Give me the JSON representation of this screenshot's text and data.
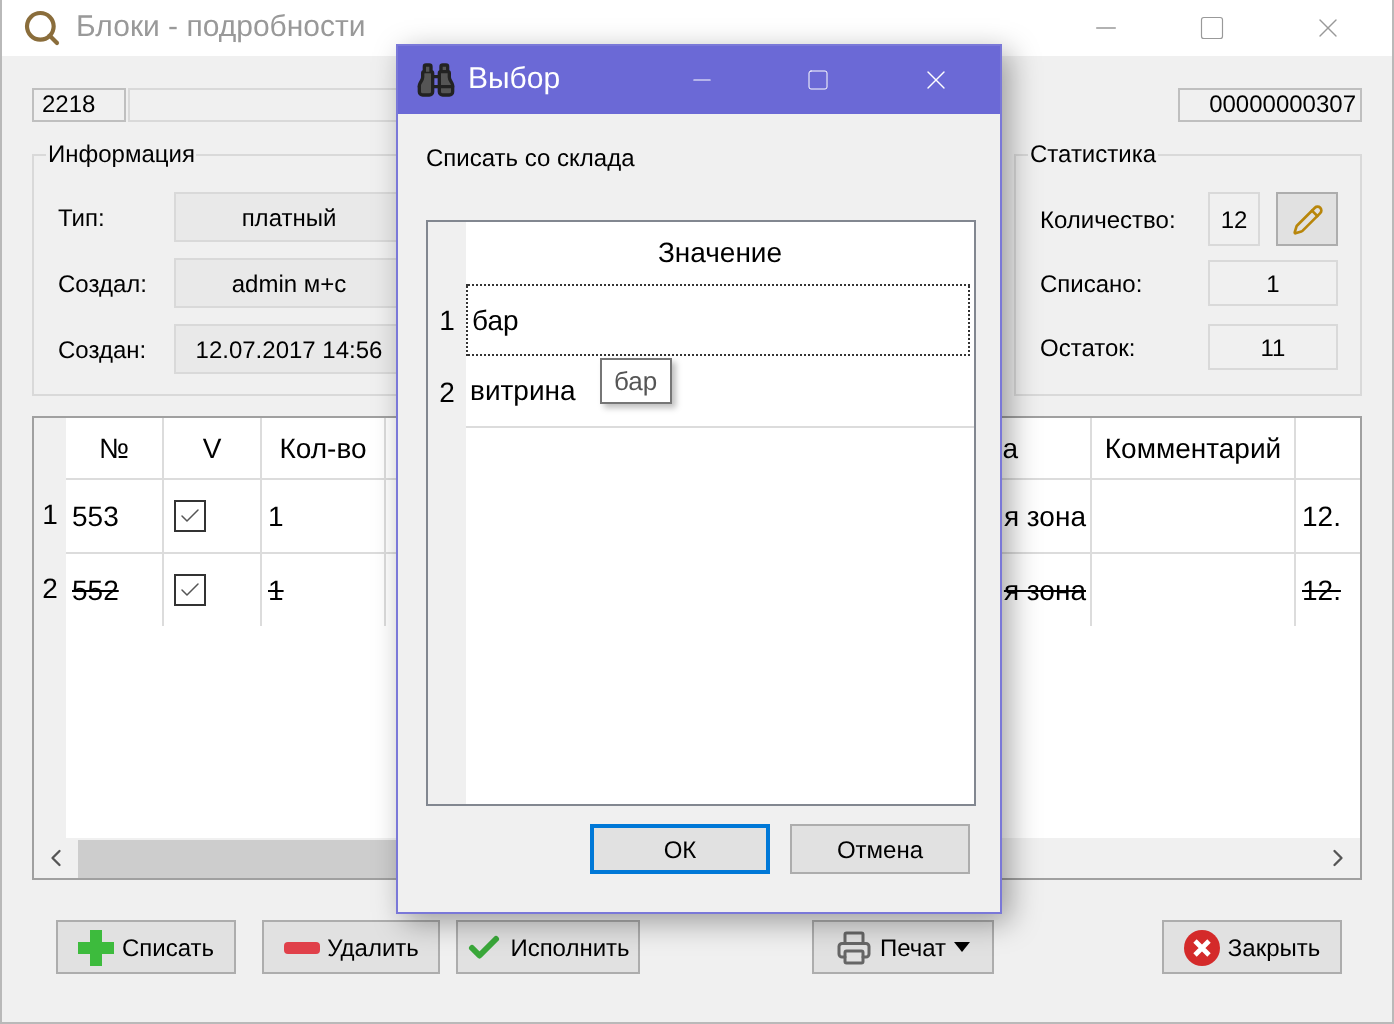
{
  "window": {
    "title": "Блоки - подробности"
  },
  "header_fields": {
    "number": "2218",
    "code": "00000000307"
  },
  "info": {
    "title": "Информация",
    "rows": [
      {
        "label": "Тип:",
        "value": "платный"
      },
      {
        "label": "Создал:",
        "value": "admin м+с"
      },
      {
        "label": "Создан:",
        "value": "12.07.2017 14:56"
      }
    ]
  },
  "stats": {
    "title": "Статистика",
    "rows": [
      {
        "label": "Количество:",
        "value": "12",
        "kind": "editable"
      },
      {
        "label": "Списано:",
        "value": "1",
        "kind": "readonly"
      },
      {
        "label": "Остаток:",
        "value": "11",
        "kind": "readonly"
      }
    ]
  },
  "table": {
    "columns": [
      "№",
      "V",
      "Кол-во",
      "а",
      "Комментарий"
    ],
    "rows": [
      {
        "number": "1",
        "deleted": false,
        "cells": [
          {
            "kind": "text",
            "text": "553"
          },
          {
            "kind": "check",
            "checked": true
          },
          {
            "kind": "text",
            "text": "1"
          },
          {
            "kind": "text",
            "text": "я зона"
          },
          {
            "kind": "text",
            "text": ""
          },
          {
            "kind": "text",
            "text": "12."
          }
        ]
      },
      {
        "number": "2",
        "deleted": true,
        "cells": [
          {
            "kind": "text",
            "text": "552"
          },
          {
            "kind": "check",
            "checked": true
          },
          {
            "kind": "text",
            "text": "1"
          },
          {
            "kind": "text",
            "text": "я зона"
          },
          {
            "kind": "text",
            "text": ""
          },
          {
            "kind": "text",
            "text": "12."
          }
        ]
      }
    ]
  },
  "buttons": [
    {
      "label": "Списать",
      "kind": "plus"
    },
    {
      "label": "Удалить",
      "kind": "minus"
    },
    {
      "label": "Исполнить",
      "kind": "check"
    },
    {
      "label": "Печат",
      "kind": "print"
    },
    {
      "label": "Закрыть",
      "kind": "close"
    }
  ],
  "dialog": {
    "title": "Выбор",
    "prompt": "Списать со склада",
    "column": "Значение",
    "rows": [
      {
        "number": "1",
        "value": "бар",
        "focused": true
      },
      {
        "number": "2",
        "value": "витрина",
        "focused": false
      }
    ],
    "tooltip": "бар",
    "buttons": [
      {
        "label": "ОК",
        "default": true
      },
      {
        "label": "Отмена",
        "default": false
      }
    ]
  }
}
